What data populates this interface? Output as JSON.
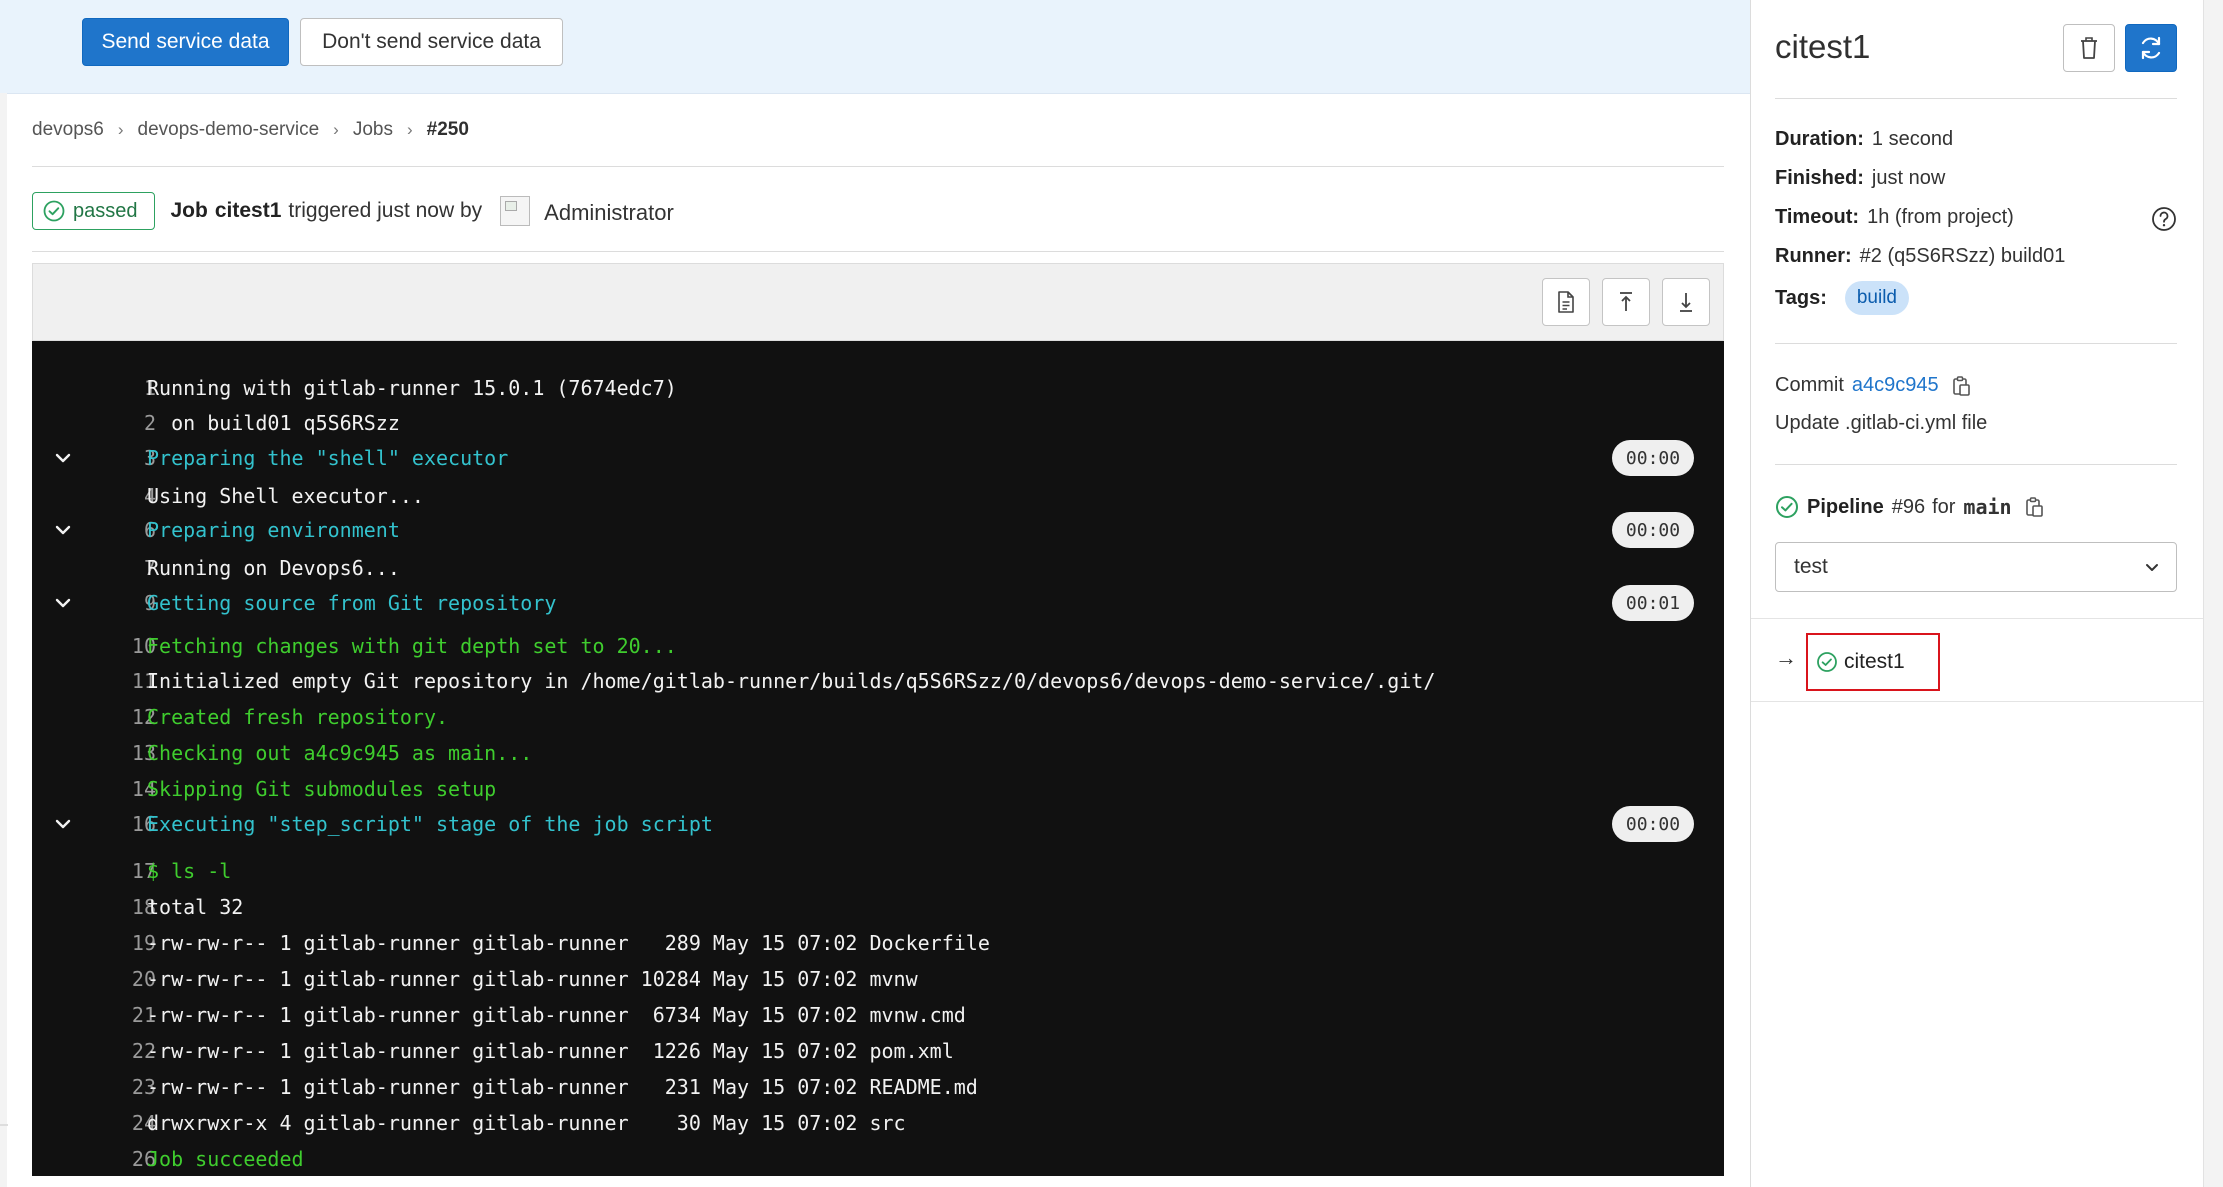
{
  "banner": {
    "send_label": "Send service data",
    "dont_send_label": "Don't send service data"
  },
  "breadcrumb": [
    "devops6",
    "devops-demo-service",
    "Jobs",
    "#250"
  ],
  "job": {
    "status": "passed",
    "title_prefix": "Job",
    "name": "citest1",
    "triggered_text": "triggered just now by",
    "user": "Administrator"
  },
  "log_lines": [
    {
      "n": "1",
      "text": "Running with gitlab-runner 15.0.1 (7674edc7)",
      "color": "white",
      "section": false
    },
    {
      "n": "2",
      "text": "  on build01 q5S6RSzz",
      "color": "white",
      "section": false
    },
    {
      "n": "3",
      "text": "Preparing the \"shell\" executor",
      "color": "cyan",
      "section": true,
      "duration": "00:00"
    },
    {
      "n": "4",
      "text": "Using Shell executor...",
      "color": "white",
      "section": false
    },
    {
      "n": "6",
      "text": "Preparing environment",
      "color": "cyan",
      "section": true,
      "duration": "00:00"
    },
    {
      "n": "7",
      "text": "Running on Devops6...",
      "color": "white",
      "section": false
    },
    {
      "n": "9",
      "text": "Getting source from Git repository",
      "color": "cyan",
      "section": true,
      "duration": "00:01"
    },
    {
      "n": "10",
      "text": "Fetching changes with git depth set to 20...",
      "color": "green",
      "section": false
    },
    {
      "n": "11",
      "text": "Initialized empty Git repository in /home/gitlab-runner/builds/q5S6RSzz/0/devops6/devops-demo-service/.git/",
      "color": "white",
      "section": false
    },
    {
      "n": "12",
      "text": "Created fresh repository.",
      "color": "green",
      "section": false
    },
    {
      "n": "13",
      "text": "Checking out a4c9c945 as main...",
      "color": "green",
      "section": false
    },
    {
      "n": "14",
      "text": "Skipping Git submodules setup",
      "color": "green",
      "section": false
    },
    {
      "n": "16",
      "text": "Executing \"step_script\" stage of the job script",
      "color": "cyan",
      "section": true,
      "duration": "00:00"
    },
    {
      "n": "17",
      "text": "$ ls -l",
      "color": "green",
      "section": false
    },
    {
      "n": "18",
      "text": "total 32",
      "color": "white",
      "section": false
    },
    {
      "n": "19",
      "text": "-rw-rw-r-- 1 gitlab-runner gitlab-runner   289 May 15 07:02 Dockerfile",
      "color": "white",
      "section": false
    },
    {
      "n": "20",
      "text": "-rw-rw-r-- 1 gitlab-runner gitlab-runner 10284 May 15 07:02 mvnw",
      "color": "white",
      "section": false
    },
    {
      "n": "21",
      "text": "-rw-rw-r-- 1 gitlab-runner gitlab-runner  6734 May 15 07:02 mvnw.cmd",
      "color": "white",
      "section": false
    },
    {
      "n": "22",
      "text": "-rw-rw-r-- 1 gitlab-runner gitlab-runner  1226 May 15 07:02 pom.xml",
      "color": "white",
      "section": false
    },
    {
      "n": "23",
      "text": "-rw-rw-r-- 1 gitlab-runner gitlab-runner   231 May 15 07:02 README.md",
      "color": "white",
      "section": false
    },
    {
      "n": "24",
      "text": "drwxrwxr-x 4 gitlab-runner gitlab-runner    30 May 15 07:02 src",
      "color": "white",
      "section": false
    },
    {
      "n": "26",
      "text": "Job succeeded",
      "color": "green",
      "section": false
    }
  ],
  "sidebar": {
    "title": "citest1",
    "duration_label": "Duration:",
    "duration": "1 second",
    "finished_label": "Finished:",
    "finished": "just now",
    "timeout_label": "Timeout:",
    "timeout": "1h (from project)",
    "runner_label": "Runner:",
    "runner": "#2 (q5S6RSzz) build01",
    "tags_label": "Tags:",
    "tag": "build",
    "commit_label": "Commit",
    "commit_sha": "a4c9c945",
    "commit_message": "Update .gitlab-ci.yml file",
    "pipeline_label": "Pipeline",
    "pipeline_id": "#96",
    "pipeline_for": "for",
    "pipeline_ref": "main",
    "stage": "test",
    "current_job": "citest1"
  },
  "colors": {
    "primary": "#1f75cb",
    "success": "#2da160",
    "log_bg": "#111111",
    "log_cyan": "#33c2cd",
    "log_green": "#3fcd2e",
    "highlight": "#d9141c"
  }
}
